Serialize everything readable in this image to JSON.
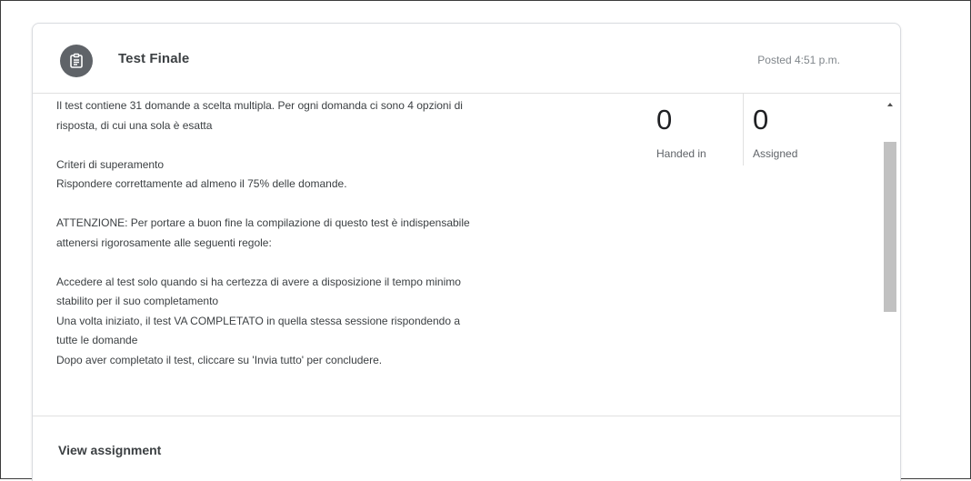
{
  "card": {
    "title": "Test Finale",
    "posted": "Posted 4:51 p.m.",
    "icon": "assignment-icon"
  },
  "description": {
    "line1": "Il test contiene 31 domande a scelta multipla. Per ogni domanda ci sono 4 opzioni di",
    "line2": "risposta, di cui una sola è esatta",
    "line3": "Criteri di superamento",
    "line4": "Rispondere correttamente ad almeno il 75% delle domande.",
    "line5": "ATTENZIONE: Per portare a buon fine la compilazione di questo test è indispensabile",
    "line6": "attenersi rigorosamente alle seguenti regole:",
    "line7": "Accedere al test solo quando si ha certezza di avere a disposizione il tempo minimo",
    "line8": "stabilito per il suo completamento",
    "line9": "Una volta iniziato, il test VA COMPLETATO in quella stessa sessione rispondendo a",
    "line10": "tutte le domande",
    "line11": "Dopo aver completato il test, cliccare su 'Invia tutto' per concludere."
  },
  "stats": {
    "handed_in_count": "0",
    "handed_in_label": "Handed in",
    "assigned_count": "0",
    "assigned_label": "Assigned"
  },
  "footer": {
    "view_label": "View assignment"
  }
}
